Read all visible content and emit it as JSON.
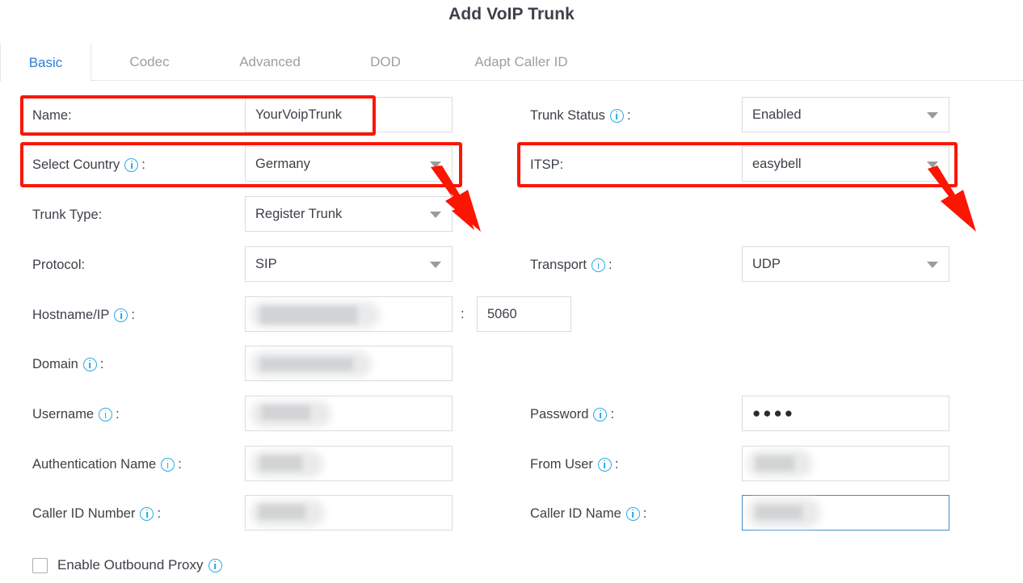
{
  "header": {
    "title": "Add VoIP Trunk"
  },
  "tabs": [
    {
      "label": "Basic",
      "active": true
    },
    {
      "label": "Codec",
      "active": false
    },
    {
      "label": "Advanced",
      "active": false
    },
    {
      "label": "DOD",
      "active": false
    },
    {
      "label": "Adapt Caller ID",
      "active": false
    }
  ],
  "form": {
    "name": {
      "label": "Name:",
      "value": "YourVoipTrunk"
    },
    "select_country": {
      "label": "Select Country",
      "colon": ":",
      "value": "Germany"
    },
    "trunk_type": {
      "label": "Trunk Type:",
      "value": "Register Trunk"
    },
    "protocol": {
      "label": "Protocol:",
      "value": "SIP"
    },
    "hostname_ip": {
      "label": "Hostname/IP",
      "colon": ":",
      "value": ""
    },
    "port": {
      "separator": ":",
      "value": "5060"
    },
    "domain": {
      "label": "Domain",
      "colon": ":",
      "value": ""
    },
    "username": {
      "label": "Username",
      "colon": ":",
      "value": ""
    },
    "authentication_name": {
      "label": "Authentication Name",
      "colon": ":",
      "value": ""
    },
    "caller_id_number": {
      "label": "Caller ID Number",
      "colon": ":",
      "value": ""
    },
    "trunk_status": {
      "label": "Trunk Status",
      "colon": ":",
      "value": "Enabled"
    },
    "itsp": {
      "label": "ITSP:",
      "value": "easybell"
    },
    "transport": {
      "label": "Transport",
      "colon": ":",
      "value": "UDP"
    },
    "password": {
      "label": "Password",
      "colon": ":",
      "value": "●●●●"
    },
    "from_user": {
      "label": "From User",
      "colon": ":",
      "value": ""
    },
    "caller_id_name": {
      "label": "Caller ID Name",
      "colon": ":",
      "value": ""
    },
    "enable_outbound_proxy": {
      "label": "Enable Outbound Proxy",
      "checked": false
    }
  },
  "annotations": {
    "highlight_color": "#fb1502",
    "boxes": [
      "name-row",
      "select-country-row",
      "itsp-row"
    ],
    "arrows": [
      "country-dropdown-arrow",
      "itsp-dropdown-arrow"
    ]
  },
  "colors": {
    "accent": "#2b7fd4",
    "info_icon": "#29abe2",
    "annotation": "#fb1502",
    "focus_border": "#3d8ec9",
    "text": "#3c4148",
    "muted_text": "#9aa0a6",
    "field_border": "#d9dcdf"
  }
}
